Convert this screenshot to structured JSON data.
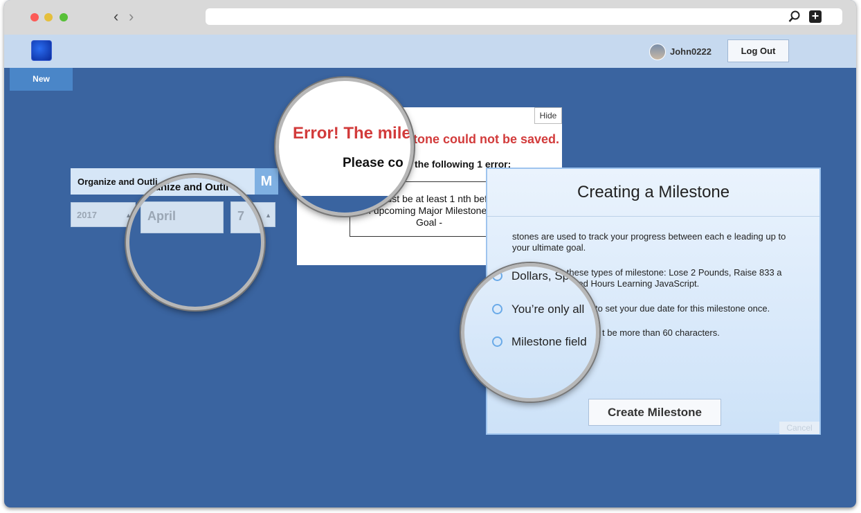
{
  "header": {
    "username": "John0222",
    "logout_label": "Log Out"
  },
  "nav": {
    "new_label": "New"
  },
  "goal": {
    "title": "Organize and Outli",
    "badge": "M"
  },
  "date": {
    "year": "2017",
    "month": "April",
    "day": "7"
  },
  "error_dialog": {
    "hide_label": "Hide",
    "title": "Error! The milestone could not be saved.",
    "title_lens": "Error! The mile",
    "subtitle": "Please correct the following 1 error:",
    "subtitle_lens": "Please co",
    "subtitle_rest": "the following 1 error:",
    "message": "date must be at least 1 nth before an upcoming Major Milestone or Goal -"
  },
  "milestone_panel": {
    "title": "Creating a Milestone",
    "info_1": "stones are used to track your progress between each e leading up to your ultimate goal.",
    "info_2": "for these types of milestone: Lose 2 Pounds, Raise 833 a Hundred Hours Learning JavaScript.",
    "info_3": "to set your due date for this milestone once.",
    "info_4": "t be more than 60 characters.",
    "lens_line_1": "Dollars, Sp",
    "lens_line_2": "You’re only all",
    "lens_line_3": "Milestone field",
    "create_label": "Create Milestone",
    "cancel_label": "Cancel"
  },
  "colors": {
    "background": "#3a64a0",
    "error": "#d23b3b",
    "accent": "#4a86c8"
  }
}
